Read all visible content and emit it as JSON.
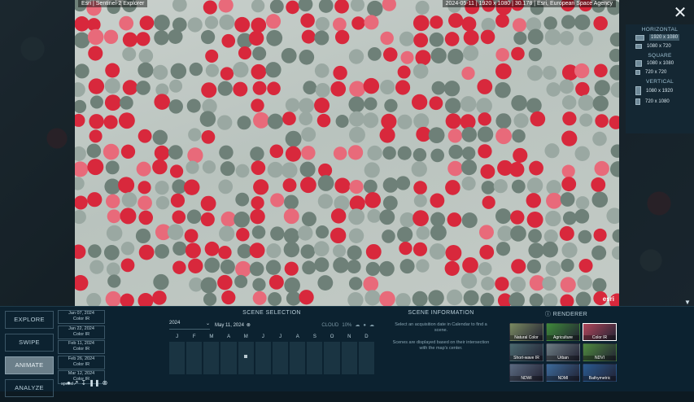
{
  "preview": {
    "title": "Esri | Sentinel-2 Explorer",
    "attribution": "2024-05-11 | 1920 x 1080 | 30.178 | Esri, European Space Agency",
    "logo": "esri"
  },
  "close_label": "✕",
  "size_panel": {
    "groups": [
      {
        "heading": "HORIZONTAL",
        "options": [
          "1920 x 1080",
          "1080 x 720"
        ]
      },
      {
        "heading": "SQUARE",
        "options": [
          "1080 x 1080",
          "720 x 720"
        ]
      },
      {
        "heading": "VERTICAL",
        "options": [
          "1080 x 1920",
          "720 x 1080"
        ]
      }
    ],
    "selected": "1920 x 1080"
  },
  "modes": [
    "EXPLORE",
    "SWIPE",
    "ANIMATE",
    "ANALYZE"
  ],
  "active_mode": "ANIMATE",
  "frames": [
    {
      "date": "Jan 07, 2024",
      "renderer": "Color IR"
    },
    {
      "date": "Jan 22, 2024",
      "renderer": "Color IR"
    },
    {
      "date": "Feb 11, 2024",
      "renderer": "Color IR"
    },
    {
      "date": "Feb 26, 2024",
      "renderer": "Color IR"
    },
    {
      "date": "Mar 12, 2024",
      "renderer": "Color IR"
    }
  ],
  "speed_label": "speed",
  "scene_selection": {
    "title": "SCENE SELECTION",
    "year": "2024",
    "date": "May 11, 2024",
    "cloud_label": "CLOUD",
    "cloud_value": "10%",
    "months": [
      "J",
      "F",
      "M",
      "A",
      "M",
      "J",
      "J",
      "A",
      "S",
      "O",
      "N",
      "D"
    ],
    "available_month_index": 4
  },
  "scene_info": {
    "title": "SCENE INFORMATION",
    "line1": "Select an acquisition date in Calendar to find a scene.",
    "line2": "Scenes are displayed based on their intersection with the map's center."
  },
  "renderer": {
    "title": "RENDERER",
    "tiles": [
      {
        "label": "Natural Color",
        "color": "#7a8a60"
      },
      {
        "label": "Agriculture",
        "color": "#3f8a3a"
      },
      {
        "label": "Color IR",
        "color": "#b0465a"
      },
      {
        "label": "Short-wave IR",
        "color": "#4b6a70"
      },
      {
        "label": "Urban",
        "color": "#6d7d83"
      },
      {
        "label": "NDVI",
        "color": "#4f8a3f"
      },
      {
        "label": "NDWI",
        "color": "#5a6a80"
      },
      {
        "label": "NDMI",
        "color": "#3c6a9a"
      },
      {
        "label": "Bathymetric",
        "color": "#2a5a90"
      }
    ],
    "selected": "Color IR"
  }
}
